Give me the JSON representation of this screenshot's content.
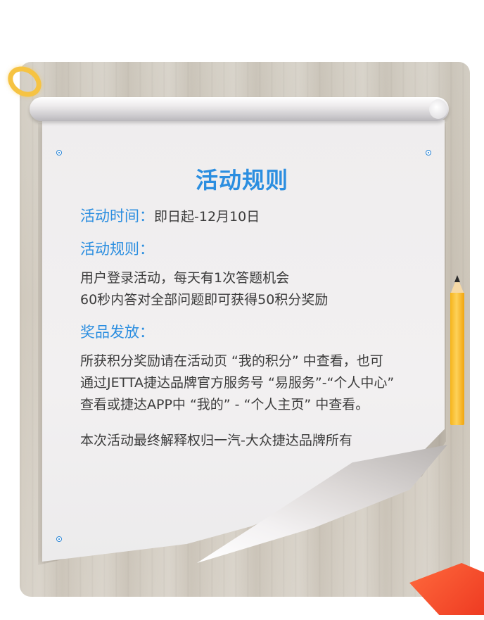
{
  "title": "活动规则",
  "time": {
    "label": "活动时间：",
    "value": "即日起-12月10日"
  },
  "rules": {
    "heading": "活动规则：",
    "lines": [
      "用户登录活动，每天有1次答题机会",
      "60秒内答对全部问题即可获得50积分奖励"
    ]
  },
  "prize": {
    "heading": "奖品发放：",
    "lines": [
      "所获积分奖励请在活动页 “我的积分” 中查看，也可",
      "通过JETTA捷达品牌官方服务号 “易服务”-“个人中心”",
      "查看或捷达APP中 “我的” - “个人主页” 中查看。"
    ]
  },
  "footer": "本次活动最终解释权归一汽-大众捷达品牌所有",
  "colors": {
    "accent": "#2b8ee0",
    "text": "#3b3b3b",
    "pencil": "#f6b41a",
    "corner": "#ee3b22"
  },
  "icons": [
    "halo-icon",
    "pin-icon",
    "pencil-icon"
  ]
}
